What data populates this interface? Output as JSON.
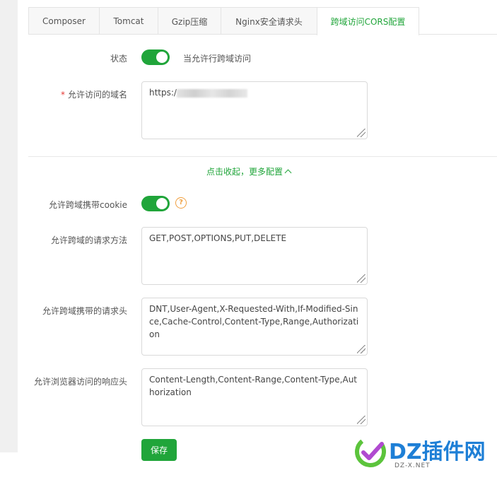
{
  "tabs": [
    {
      "label": "Composer",
      "active": false
    },
    {
      "label": "Tomcat",
      "active": false
    },
    {
      "label": "Gzip压缩",
      "active": false
    },
    {
      "label": "Nginx安全请求头",
      "active": false
    },
    {
      "label": "跨域访问CORS配置",
      "active": true
    }
  ],
  "form": {
    "status_label": "状态",
    "status_toggle_text": "当允许行跨域访问",
    "status_on": true,
    "domain_label": "允许访问的域名",
    "domain_required_mark": "*",
    "domain_value": "https:/",
    "collapse_link_text": "点击收起，更多配置",
    "cookie_label": "允许跨域携带cookie",
    "cookie_on": true,
    "help_glyph": "?",
    "methods_label": "允许跨域的请求方法",
    "methods_value": "GET,POST,OPTIONS,PUT,DELETE",
    "headers_label": "允许跨域携带的请求头",
    "headers_value": "DNT,User-Agent,X-Requested-With,If-Modified-Since,Cache-Control,Content-Type,Range,Authorization",
    "expose_label": "允许浏览器访问的响应头",
    "expose_value": "Content-Length,Content-Range,Content-Type,Authorization",
    "save_label": "保存"
  },
  "watermark": {
    "brand": "DZ插件网",
    "sub": "DZ-X.NET"
  },
  "colors": {
    "accent": "#20a53a",
    "required": "#e53935",
    "help": "#f0a040",
    "watermark": "#1e7fd6"
  }
}
